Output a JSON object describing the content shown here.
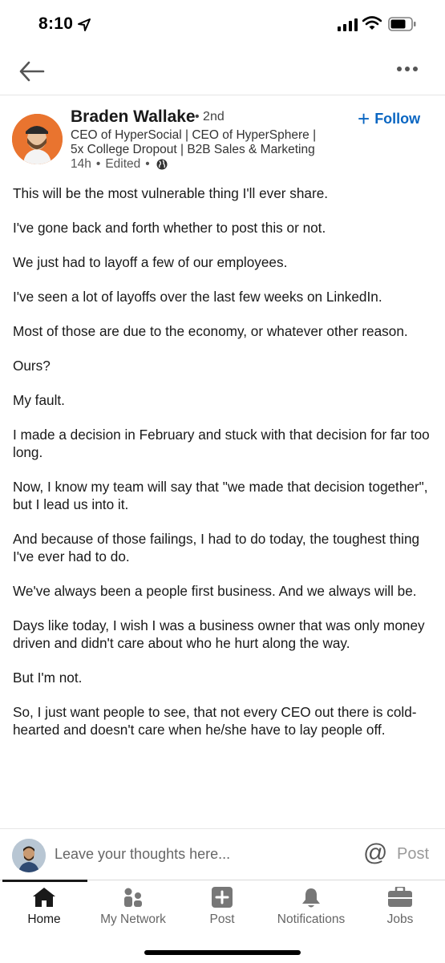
{
  "status_bar": {
    "time": "8:10"
  },
  "post": {
    "author_name": "Braden Wallake",
    "connection_degree": "• 2nd",
    "headline_line1": "CEO of HyperSocial | CEO of HyperSphere |",
    "headline_line2": "5x College Dropout | B2B Sales & Marketing",
    "timestamp": "14h",
    "edited": "Edited",
    "follow_label": "Follow",
    "paragraphs": [
      "This will be the most vulnerable thing I'll ever share.",
      "I've gone back and forth whether to post this or not.",
      "We just had to layoff a few of our employees.",
      "I've seen a lot of layoffs over the last few weeks on LinkedIn.",
      "Most of those are due to the economy, or whatever other reason.",
      "Ours?",
      "My fault.",
      "I made a decision in February and stuck with that decision for far too long.",
      "Now, I know my team will say that \"we made that decision together\", but I lead us into it.",
      "And because of those failings, I had to do today, the toughest thing I've ever had to do.",
      "We've always been a people first business. And we always will be.",
      "Days like today, I wish I was a business owner that was only money driven and didn't care about who he hurt along the way.",
      "But I'm not.",
      "So, I just want people to see, that not every CEO out there is cold-hearted and doesn't care when he/she have to lay people off."
    ]
  },
  "comment_bar": {
    "placeholder": "Leave your thoughts here...",
    "mention_symbol": "@",
    "post_label": "Post"
  },
  "bottom_nav": {
    "items": [
      {
        "label": "Home",
        "icon": "home-icon"
      },
      {
        "label": "My Network",
        "icon": "network-icon"
      },
      {
        "label": "Post",
        "icon": "plus-square-icon"
      },
      {
        "label": "Notifications",
        "icon": "bell-icon"
      },
      {
        "label": "Jobs",
        "icon": "briefcase-icon"
      }
    ]
  },
  "colors": {
    "accent": "#0a66c2",
    "avatar_bg": "#e9742f"
  }
}
